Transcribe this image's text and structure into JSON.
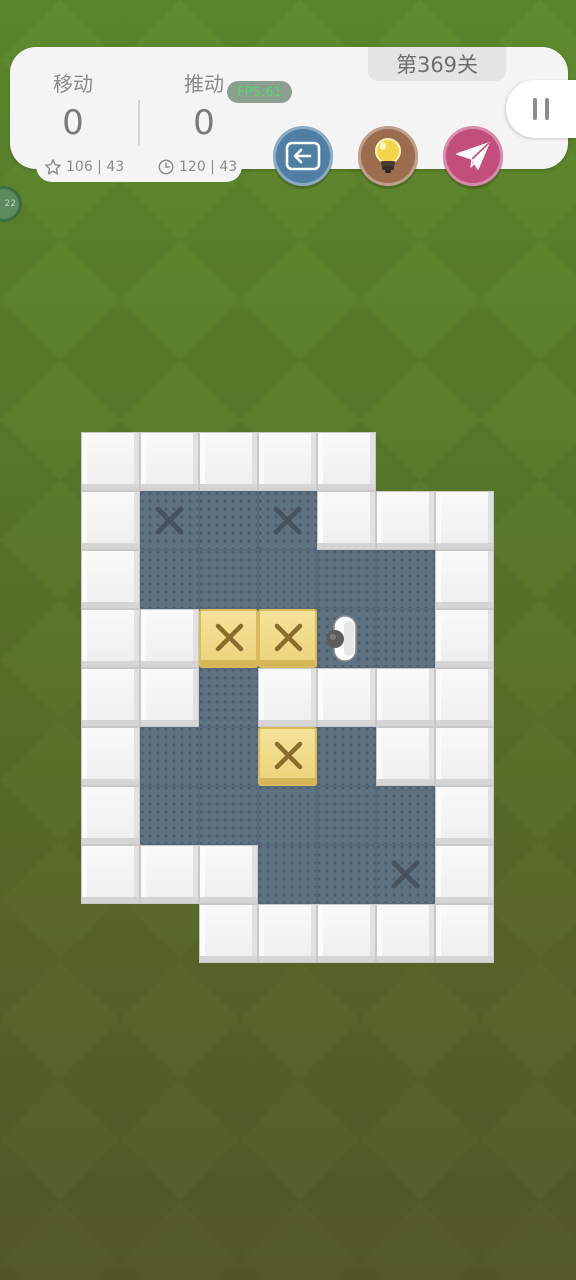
{
  "header": {
    "level_label": "第369关",
    "moves_label": "移动",
    "moves_value": "0",
    "pushes_label": "推动",
    "pushes_value": "0",
    "star_stat": "106 | 43",
    "time_stat": "120 | 43",
    "fps_label": "FPS:61",
    "side_chip": "22"
  },
  "buttons": {
    "undo_icon": "back-arrow-icon",
    "hint_icon": "lightbulb-icon",
    "share_icon": "paper-plane-icon",
    "undo_color": "#4f7fa3",
    "hint_color": "#9c6c4e",
    "share_color": "#c24e7c"
  },
  "board": {
    "cols": 7,
    "rows": 9,
    "legend": {
      "#": "wall",
      ".": "floor",
      "G": "goal",
      "B": "box",
      "P": "player",
      " ": "empty"
    },
    "rows_map": [
      "#####  ",
      "#G.G###",
      "#.....#",
      "##BBP.#",
      "##.####",
      "#..B.##",
      "#.....#",
      "###..G#",
      "  #####"
    ]
  }
}
